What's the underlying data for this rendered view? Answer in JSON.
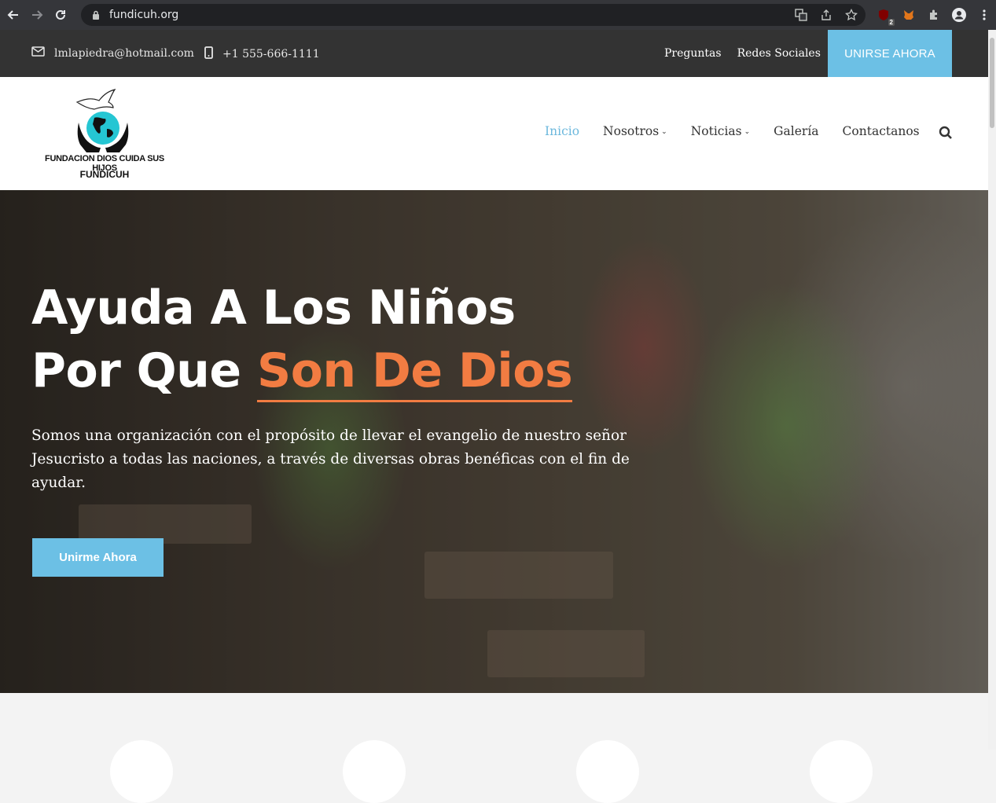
{
  "browser": {
    "url": "fundicuh.org",
    "extension_badge": "2"
  },
  "topbar": {
    "email": "lmlapiedra@hotmail.com",
    "phone": "+1 555-666-1111",
    "links": [
      "Preguntas",
      "Redes Sociales"
    ],
    "join_label": "UNIRSE AHORA",
    "accent_color": "#6cc0e5"
  },
  "header": {
    "logo_line1": "FUNDACION DIOS CUIDA SUS HIJOS",
    "logo_line2": "FUNDICUH",
    "menu": [
      {
        "label": "Inicio",
        "active": true
      },
      {
        "label": "Nosotros",
        "dropdown": true
      },
      {
        "label": "Noticias",
        "dropdown": true
      },
      {
        "label": "Galería"
      },
      {
        "label": "Contactanos"
      }
    ]
  },
  "hero": {
    "title_line1": "Ayuda A Los Niños",
    "title_line2_prefix": "Por Que ",
    "title_line2_accent": "Son De Dios",
    "accent_color": "#f27c42",
    "lead": "Somos una organización con el propósito de llevar el evangelio de nuestro señor Jesucristo a todas las naciones, a través de diversas obras benéficas con el fin de ayudar.",
    "cta_label": "Unirme Ahora"
  }
}
